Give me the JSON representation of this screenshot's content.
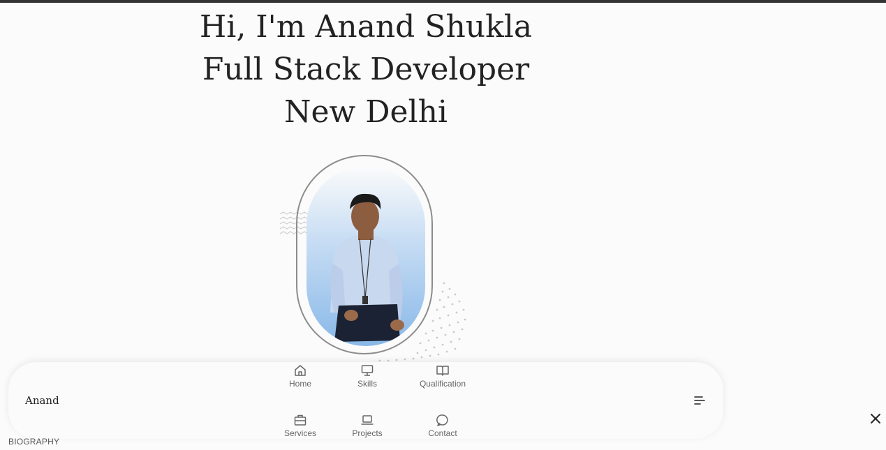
{
  "hero": {
    "line1": "Hi, I'm Anand Shukla",
    "line2": "Full Stack Developer",
    "line3": "New Delhi"
  },
  "nav": {
    "brand": "Anand",
    "items": [
      {
        "label": "Home",
        "icon": "home-icon"
      },
      {
        "label": "Skills",
        "icon": "monitor-icon"
      },
      {
        "label": "Qualification",
        "icon": "book-icon"
      },
      {
        "label": "Services",
        "icon": "briefcase-icon"
      },
      {
        "label": "Projects",
        "icon": "laptop-icon"
      },
      {
        "label": "Contact",
        "icon": "message-icon"
      }
    ],
    "menu_icon": "menu-icon",
    "close_icon": "close-icon"
  },
  "footer": {
    "section_label": "BIOGRAPHY"
  },
  "colors": {
    "text": "#222222",
    "muted": "#666666",
    "frame": "#8c8c8c",
    "portrait_blue": "#88b8e8"
  }
}
